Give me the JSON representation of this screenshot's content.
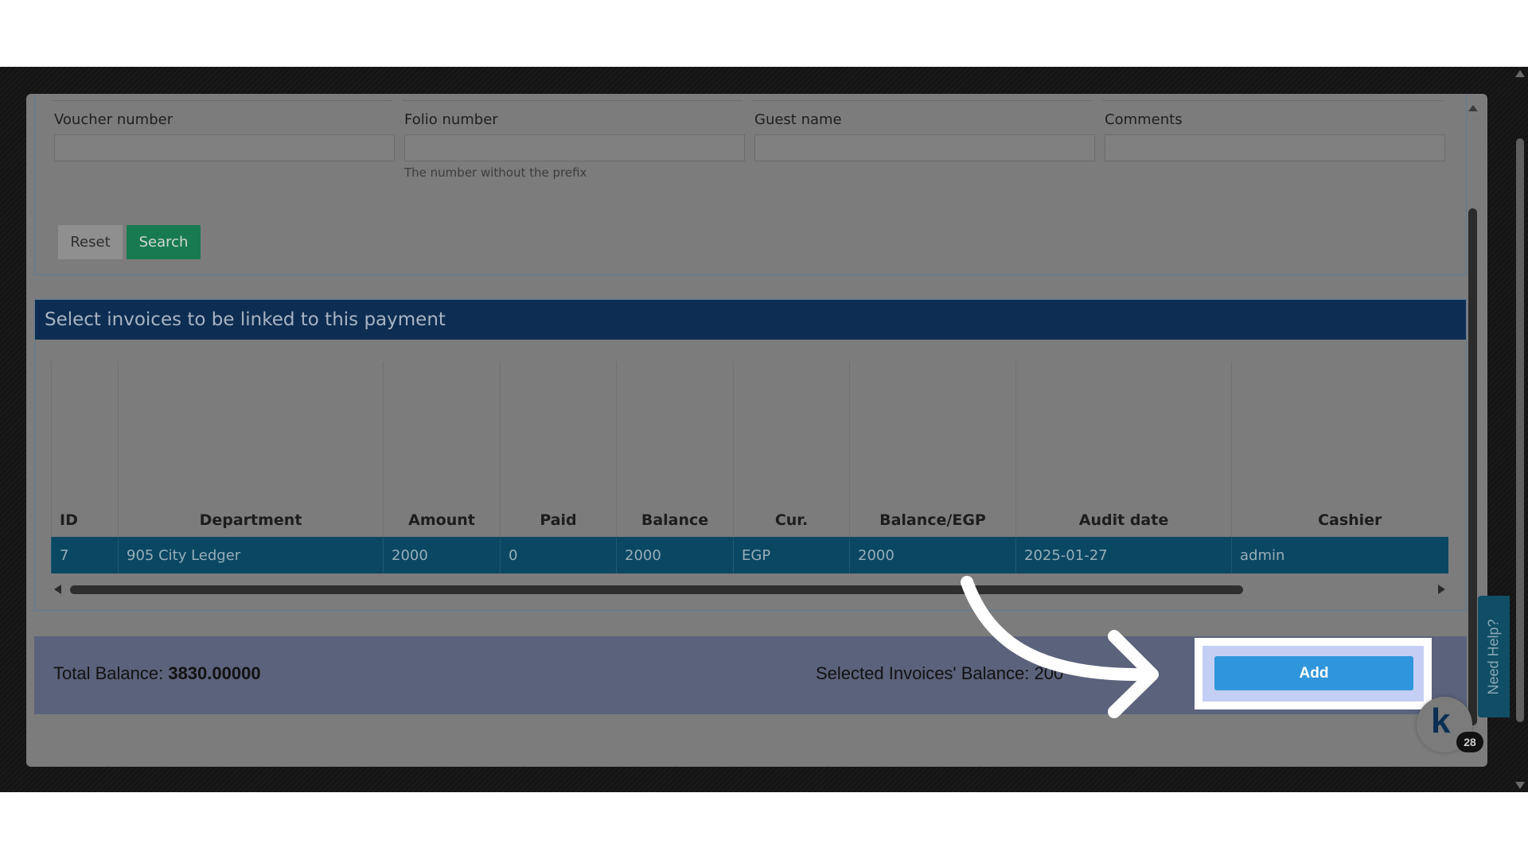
{
  "filters": {
    "voucher_label": "Voucher number",
    "folio_label": "Folio number",
    "folio_hint": "The number without the prefix",
    "guest_label": "Guest name",
    "comments_label": "Comments",
    "reset_label": "Reset",
    "search_label": "Search"
  },
  "invoices": {
    "title": "Select invoices to be linked to this payment",
    "columns": [
      "ID",
      "Department",
      "Amount",
      "Paid",
      "Balance",
      "Cur.",
      "Balance/EGP",
      "Audit date",
      "Cashier"
    ],
    "rows": [
      [
        "7",
        "905 City Ledger",
        "2000",
        "0",
        "2000",
        "EGP",
        "2000",
        "2025-01-27",
        "admin"
      ]
    ]
  },
  "totals": {
    "total_label": "Total Balance:",
    "total_value": "3830.00000",
    "selected_label": "Selected Invoices' Balance: 200",
    "add_label": "Add"
  },
  "widgets": {
    "help_label": "Need Help?",
    "bubble_letter": "k",
    "bubble_count": "28"
  },
  "colors": {
    "header_bg": "#0e2d52",
    "row_selected": "#0a4763",
    "add_button": "#2f96dc",
    "search_button": "#187a50"
  }
}
